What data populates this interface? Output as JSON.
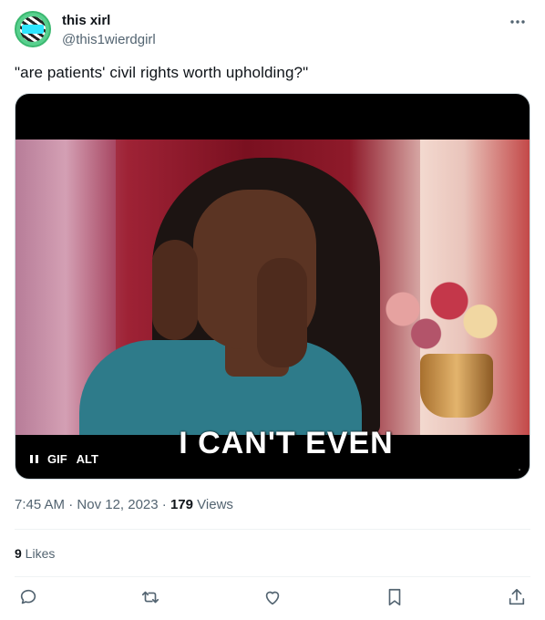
{
  "author": {
    "display_name": "this xirl",
    "handle": "@this1wierdgirl",
    "avatar_icon": "avatar-image"
  },
  "tweet": {
    "text": "\"are patients' civil rights worth upholding?\""
  },
  "media": {
    "type": "GIF",
    "caption": "I CAN'T EVEN",
    "gif_label": "GIF",
    "alt_label": "ALT",
    "pause_icon": "pause-icon"
  },
  "meta": {
    "time": "7:45 AM",
    "separator1": " · ",
    "date": "Nov 12, 2023",
    "separator2": " · ",
    "views_count": "179",
    "views_label": " Views"
  },
  "engagement": {
    "likes_count": "9",
    "likes_label": " Likes"
  },
  "actions": [
    "reply-icon",
    "retweet-icon",
    "like-icon",
    "bookmark-icon",
    "share-icon"
  ],
  "colors": {
    "text": "#0f1419",
    "secondary": "#536471",
    "divider": "#eff3f4"
  }
}
